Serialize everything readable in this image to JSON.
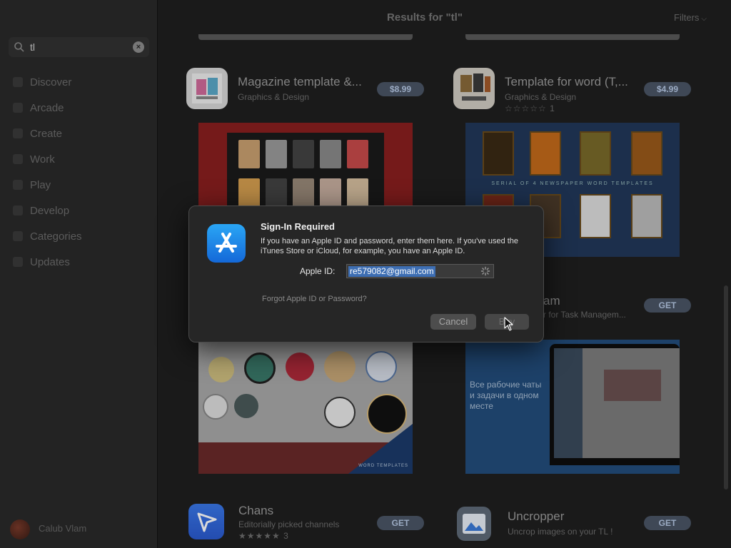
{
  "sidebar": {
    "search_query": "tl",
    "nav": [
      "Discover",
      "Arcade",
      "Create",
      "Work",
      "Play",
      "Develop",
      "Categories",
      "Updates"
    ],
    "user_name": "Calub Vlam"
  },
  "header": {
    "title": "Results for \"tl\"",
    "filters": "Filters"
  },
  "apps": [
    {
      "name": "Magazine template &...",
      "category": "Graphics & Design",
      "price": "$8.99"
    },
    {
      "name": "Template for word (T,...",
      "category": "Graphics & Design",
      "rating": "☆☆☆☆☆",
      "rating_count": "1",
      "price": "$4.99"
    },
    {
      "name": "am",
      "category": "r for Task Managem...",
      "price": "GET"
    },
    {
      "name": "Chans",
      "category": "Editorially picked channels",
      "rating": "★★★★★",
      "rating_count": "3",
      "price": "GET"
    },
    {
      "name": "Uncropper",
      "category": "Uncrop images on your TL !",
      "price": "GET"
    }
  ],
  "screenshots": {
    "flyers_caption": "SERIAL OF 4 NEWSPAPER WORD TEMPLATES",
    "stickers_caption": "WORD TEMPLATES",
    "russian_text": "Все рабочие чаты и задачи в одном месте"
  },
  "dialog": {
    "title": "Sign-In Required",
    "message": "If you have an Apple ID and password, enter them here. If you've used the iTunes Store or iCloud, for example, you have an Apple ID.",
    "apple_id_label": "Apple ID:",
    "apple_id_value": "re579082@gmail.com",
    "forgot_link": "Forgot Apple ID or Password?",
    "cancel": "Cancel",
    "buy": "Buy"
  }
}
